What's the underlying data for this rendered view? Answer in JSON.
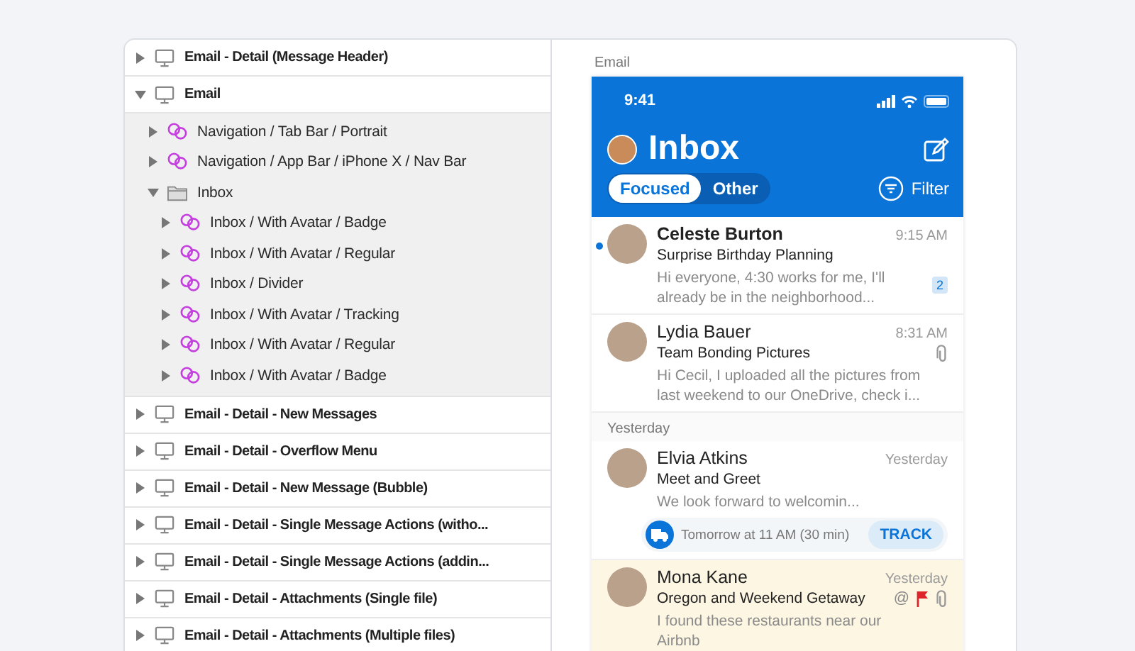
{
  "sidebar": {
    "items": [
      {
        "kind": "artboard",
        "label": "Email - Detail (Message Header)",
        "expanded": false
      },
      {
        "kind": "artboard",
        "label": "Email",
        "expanded": true,
        "children": [
          {
            "kind": "symbol",
            "label": "Navigation / Tab Bar / Portrait",
            "expanded": false
          },
          {
            "kind": "symbol",
            "label": "Navigation / App Bar / iPhone X / Nav Bar",
            "expanded": false
          },
          {
            "kind": "folder",
            "label": "Inbox",
            "expanded": true,
            "children": [
              {
                "kind": "symbol",
                "label": "Inbox / With Avatar / Badge",
                "expanded": false
              },
              {
                "kind": "symbol",
                "label": "Inbox / With Avatar / Regular",
                "expanded": false
              },
              {
                "kind": "symbol",
                "label": "Inbox / Divider",
                "expanded": false
              },
              {
                "kind": "symbol",
                "label": "Inbox / With Avatar / Tracking",
                "expanded": false
              },
              {
                "kind": "symbol",
                "label": "Inbox / With Avatar / Regular",
                "expanded": false
              },
              {
                "kind": "symbol",
                "label": "Inbox / With Avatar / Badge",
                "expanded": false
              }
            ]
          }
        ]
      },
      {
        "kind": "artboard",
        "label": "Email - Detail - New Messages",
        "expanded": false
      },
      {
        "kind": "artboard",
        "label": "Email - Detail - Overflow Menu",
        "expanded": false
      },
      {
        "kind": "artboard",
        "label": "Email - Detail - New Message (Bubble)",
        "expanded": false
      },
      {
        "kind": "artboard",
        "label": "Email - Detail - Single Message Actions (witho...",
        "expanded": false
      },
      {
        "kind": "artboard",
        "label": "Email - Detail - Single Message Actions (addin...",
        "expanded": false
      },
      {
        "kind": "artboard",
        "label": "Email - Detail - Attachments (Single file)",
        "expanded": false
      },
      {
        "kind": "artboard",
        "label": "Email - Detail - Attachments (Multiple files)",
        "expanded": false
      }
    ]
  },
  "preview": {
    "label": "Email",
    "status_bar": {
      "time": "9:41"
    },
    "title": "Inbox",
    "tabs": [
      {
        "label": "Focused",
        "selected": true
      },
      {
        "label": "Other",
        "selected": false
      }
    ],
    "filter": "Filter",
    "messages": [
      {
        "kind": "message",
        "sender": "Celeste Burton",
        "time": "9:15 AM",
        "subject": "Surprise Birthday Planning",
        "preview": "Hi everyone, 4:30 works for me, I'll already be in the neighborhood...",
        "unread": true,
        "badge": "2",
        "attachment": false,
        "flagged": false,
        "highlighted": false
      },
      {
        "kind": "message",
        "sender": "Lydia Bauer",
        "time": "8:31 AM",
        "subject": "Team Bonding Pictures",
        "preview": "Hi Cecil, I uploaded all the pictures from last weekend to our OneDrive, check i...",
        "unread": false,
        "attachment": true,
        "flagged": false,
        "highlighted": false
      },
      {
        "kind": "divider",
        "label": "Yesterday"
      },
      {
        "kind": "message",
        "sender": "Elvia Atkins",
        "time": "Yesterday",
        "subject": "Meet and Greet",
        "preview": "We look forward to welcomin...",
        "unread": false,
        "attachment": false,
        "flagged": false,
        "highlighted": false,
        "tracking": {
          "text": "Tomorrow at 11 AM (30 min)",
          "action": "TRACK"
        }
      },
      {
        "kind": "message",
        "sender": "Mona Kane",
        "time": "Yesterday",
        "subject": "Oregon and Weekend Getaway",
        "preview": "I found these restaurants near our Airbnb",
        "unread": false,
        "mention": "@",
        "attachment": true,
        "flagged": true,
        "highlighted": true
      }
    ]
  }
}
